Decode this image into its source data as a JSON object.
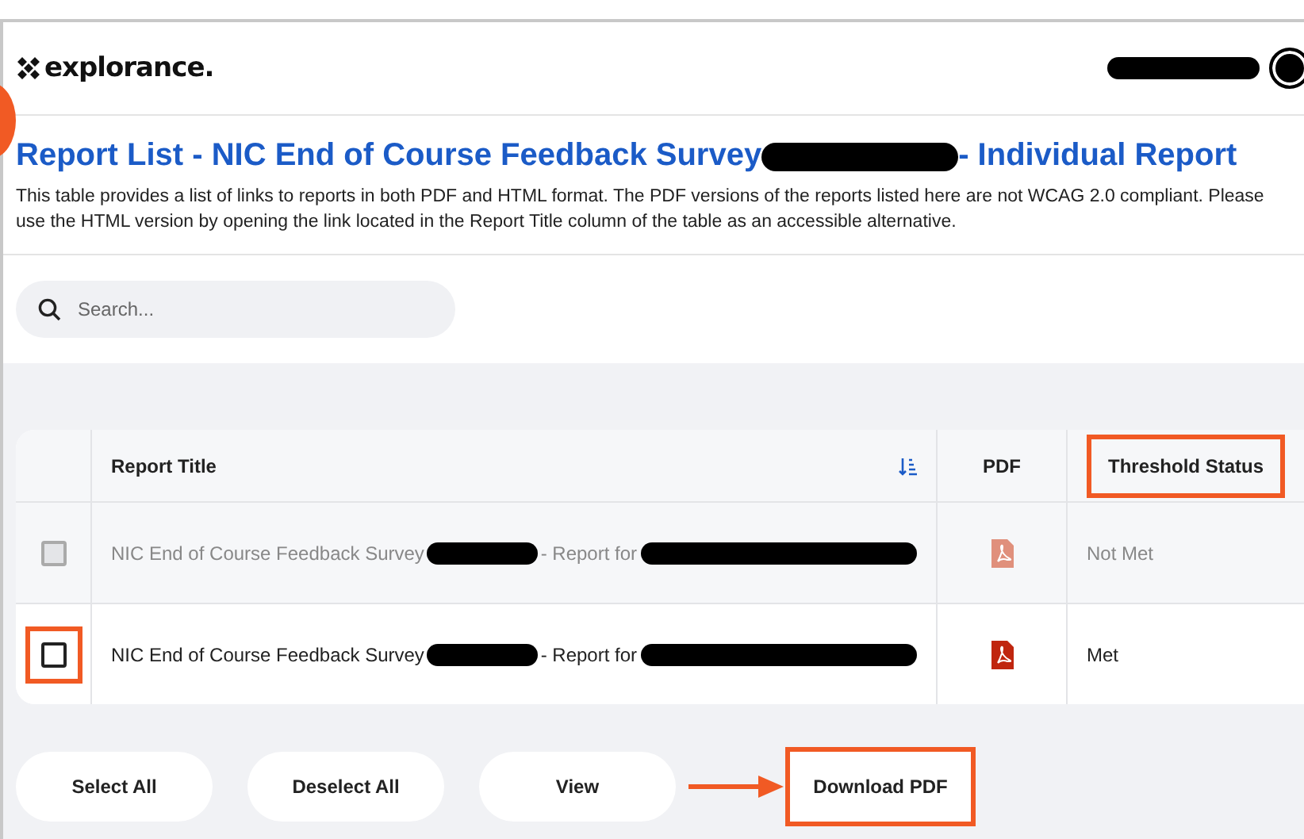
{
  "header": {
    "logo": "explorance."
  },
  "title": {
    "before": "Report List - NIC End of Course Feedback Survey",
    "after": "- Individual Report"
  },
  "description": "This table provides a list of links to reports in both PDF and HTML format. The PDF versions of the reports listed here are not WCAG 2.0 compliant. Please use the HTML version by opening the link located in the Report Title column of the table as an accessible alternative.",
  "search": {
    "placeholder": "Search..."
  },
  "table": {
    "columns": [
      {
        "label": "Report Title",
        "kind": "sortable",
        "highlighted": false
      },
      {
        "label": "PDF",
        "kind": "plain",
        "highlighted": false
      },
      {
        "label": "Threshold Status",
        "kind": "plain",
        "highlighted": true
      }
    ],
    "rows": [
      {
        "title_before": "NIC End of Course Feedback Survey",
        "title_middle": "- Report for",
        "status": "Not Met",
        "disabled": true,
        "checked": false,
        "highlighted": false
      },
      {
        "title_before": "NIC End of Course Feedback Survey",
        "title_middle": "- Report for",
        "status": "Met",
        "disabled": false,
        "checked": false,
        "highlighted": true
      }
    ]
  },
  "buttons": [
    {
      "label": "Select All",
      "highlighted": false,
      "pointed": false
    },
    {
      "label": "Deselect All",
      "highlighted": false,
      "pointed": false
    },
    {
      "label": "View",
      "highlighted": false,
      "pointed": false
    },
    {
      "label": "Download PDF",
      "highlighted": true,
      "pointed": true
    }
  ]
}
